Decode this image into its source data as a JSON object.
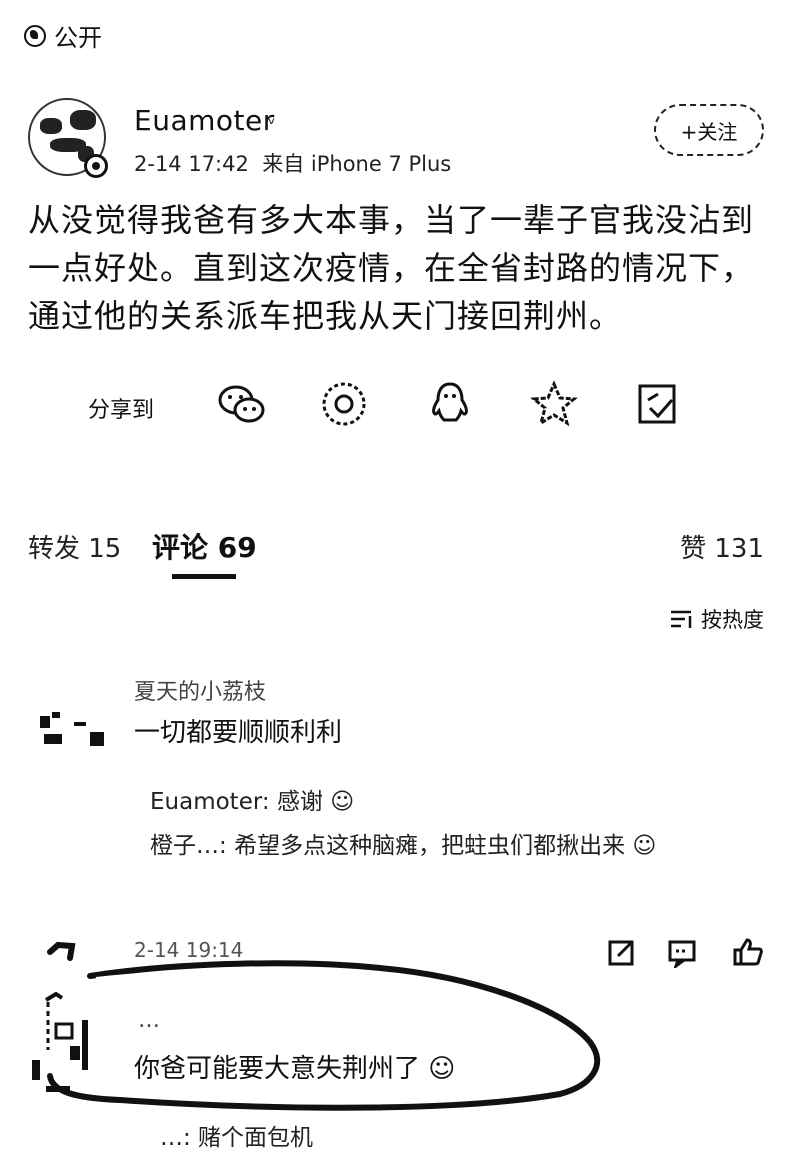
{
  "visibility": "公开",
  "post": {
    "username": "Euamoter",
    "vip_badge": "ᵛ",
    "time": "2-14 17:42",
    "source": "来自 iPhone 7 Plus",
    "follow_label": "+关注",
    "text": "从没觉得我爸有多大本事，当了一辈子官我没沾到一点好处。直到这次疫情，在全省封路的情况下，通过他的关系派车把我从天门接回荆州。"
  },
  "share": {
    "label": "分享到",
    "icons": [
      "wechat-icon",
      "moments-icon",
      "qq-icon",
      "qzone-icon",
      "save-icon"
    ]
  },
  "tabs": {
    "repost": "转发 15",
    "comments": "评论 69",
    "likes": "赞 131"
  },
  "sort_label": "按热度",
  "comments": [
    {
      "name": "夏天的小荔枝",
      "text": "一切都要顺顺利利",
      "replies": [
        {
          "name": "Euamoter:",
          "text": "感谢"
        },
        {
          "name": "橙子…:",
          "text": "希望多点这种脑瘫，把蛀虫们都揪出来"
        }
      ],
      "time": "2-14 19:14"
    },
    {
      "name": "…",
      "text": "你爸可能要大意失荆州了",
      "reply": "…: 赌个面包机"
    }
  ]
}
